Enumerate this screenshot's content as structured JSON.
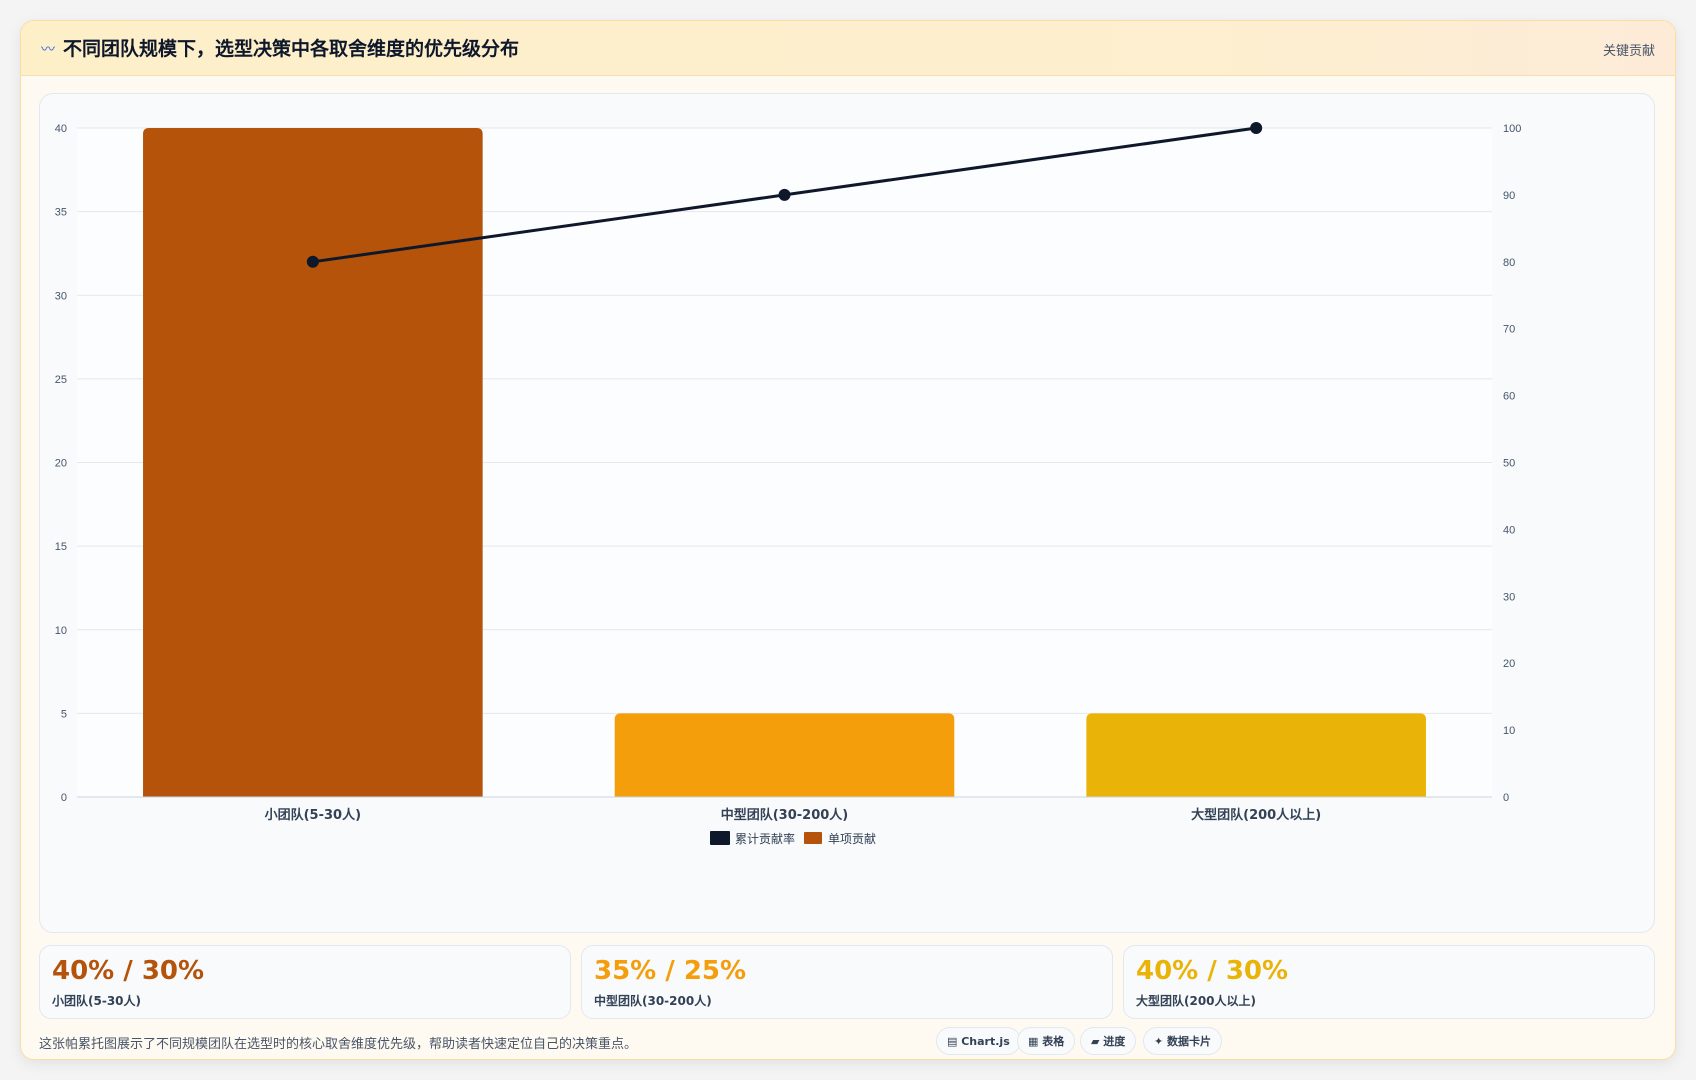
{
  "header": {
    "icon": "wave-icon",
    "title": "不同团队规模下，选型决策中各取舍维度的优先级分布",
    "action_label": "关键贡献"
  },
  "colors": {
    "bar_small": "#b45309",
    "bar_medium": "#f59e0b",
    "bar_large": "#eab308",
    "line": "#0f172a"
  },
  "chart_data": {
    "type": "bar",
    "categories": [
      "小团队(5-30人)",
      "中型团队(30-200人)",
      "大型团队(200人以上)"
    ],
    "series": [
      {
        "name": "累计贡献率",
        "type": "line",
        "axis": "right",
        "values": [
          80,
          90,
          100
        ]
      },
      {
        "name": "单项贡献",
        "type": "bar",
        "axis": "left",
        "values": [
          40,
          5,
          5
        ]
      }
    ],
    "ylim": [
      0,
      40
    ],
    "yticks": [
      0,
      5,
      10,
      15,
      20,
      25,
      30,
      35,
      40
    ],
    "y2lim": [
      0,
      100
    ],
    "y2ticks": [
      0,
      10,
      20,
      30,
      40,
      50,
      60,
      70,
      80,
      90,
      100
    ],
    "grid": true,
    "legend": "bottom-center"
  },
  "stats": [
    {
      "value": "40% / 30%",
      "label": "小团队(5-30人)",
      "color": "#b45309"
    },
    {
      "value": "35% / 25%",
      "label": "中型团队(30-200人)",
      "color": "#f59e0b"
    },
    {
      "value": "40% / 30%",
      "label": "大型团队(200人以上)",
      "color": "#eab308"
    }
  ],
  "footer": {
    "description": "这张帕累托图展示了不同规模团队在选型时的核心取舍维度优先级，帮助读者快速定位自己的决策重点。",
    "chips": [
      {
        "icon": "chart-icon",
        "label": "Chart.js"
      },
      {
        "icon": "table-icon",
        "label": "表格"
      },
      {
        "icon": "progress-icon",
        "label": "进度"
      },
      {
        "icon": "sparkle-icon",
        "label": "数据卡片"
      }
    ]
  }
}
